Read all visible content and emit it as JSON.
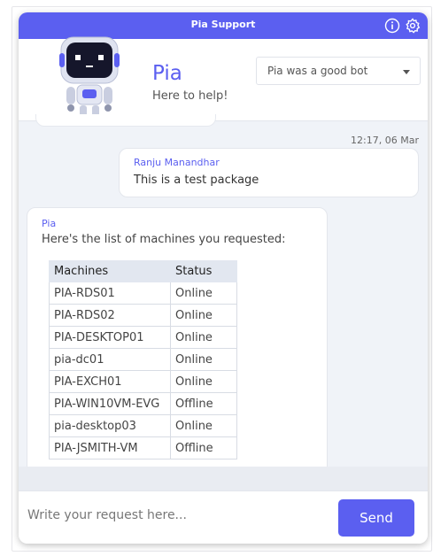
{
  "topbar": {
    "title": "Pia Support",
    "info_icon": "info-icon",
    "settings_icon": "gear-icon"
  },
  "header": {
    "bot_name": "Pia",
    "bot_subtitle": "Here to help!",
    "rating_selected": "Pia was a good bot"
  },
  "chat": {
    "timestamp": "12:17, 06 Mar",
    "user_message": {
      "author": "Ranju Manandhar",
      "text": "This is a test package"
    },
    "bot_message": {
      "author": "Pia",
      "text": "Here's the list of machines you requested:",
      "table": {
        "headers": [
          "Machines",
          "Status"
        ],
        "rows": [
          [
            "PIA-RDS01",
            "Online"
          ],
          [
            "PIA-RDS02",
            "Online"
          ],
          [
            "PIA-DESKTOP01",
            "Online"
          ],
          [
            "pia-dc01",
            "Online"
          ],
          [
            "PIA-EXCH01",
            "Online"
          ],
          [
            "PIA-WIN10VM-EVG",
            "Offline"
          ],
          [
            "pia-desktop03",
            "Online"
          ],
          [
            "PIA-JSMITH-VM",
            "Offline"
          ]
        ]
      }
    }
  },
  "composer": {
    "placeholder": "Write your request here...",
    "send_label": "Send"
  },
  "colors": {
    "accent": "#5b5ff0",
    "background": "#f0f3f8"
  }
}
